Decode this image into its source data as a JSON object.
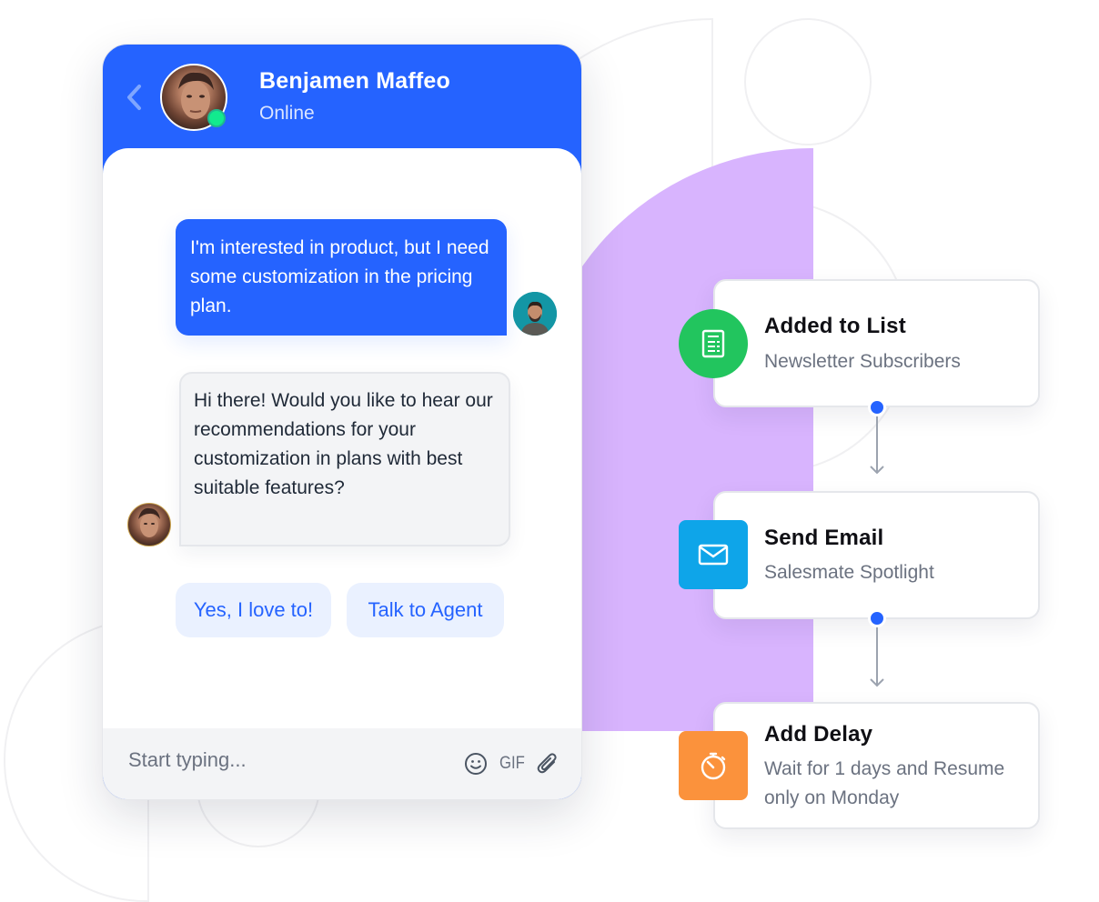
{
  "chat": {
    "contact_name": "Benjamen Maffeo",
    "contact_status": "Online",
    "messages": [
      {
        "direction": "outgoing",
        "text": "I'm interested in product, but I need some customization in the pricing plan."
      },
      {
        "direction": "incoming",
        "text": "Hi there! Would you like to hear our recommendations for your customization in plans with best suitable features?"
      }
    ],
    "quick_replies": [
      "Yes, I love to!",
      "Talk to Agent"
    ],
    "composer": {
      "placeholder": "Start typing...",
      "gif_label": "GIF",
      "icons": [
        "emoji-icon",
        "gif-icon",
        "paperclip-icon"
      ]
    }
  },
  "workflow": {
    "steps": [
      {
        "title": "Added to List",
        "subtitle": "Newsletter Subscribers",
        "icon": "list-document-icon",
        "color": "#22c55e"
      },
      {
        "title": "Send Email",
        "subtitle": "Salesmate Spotlight",
        "icon": "envelope-icon",
        "color": "#0ea5e9"
      },
      {
        "title": "Add Delay",
        "subtitle": "Wait for 1 days and Resume only on Monday",
        "icon": "stopwatch-icon",
        "color": "#fb923c"
      }
    ]
  },
  "colors": {
    "brand_blue": "#2563ff",
    "online_green": "#12ea8e",
    "accent_purple": "#d8b4fe"
  }
}
